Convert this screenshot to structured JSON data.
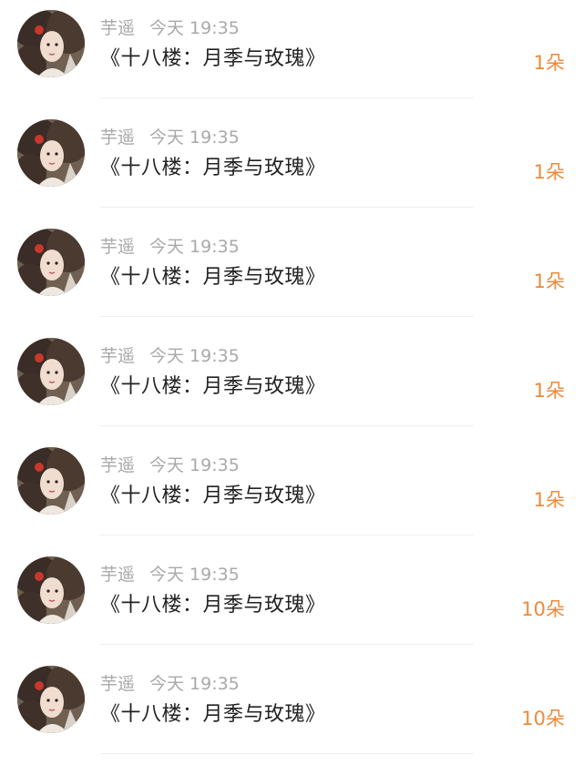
{
  "colors": {
    "name_and_time": "#a9a9a9",
    "title": "#222222",
    "count": "#ee8a3a",
    "divider": "#efefef"
  },
  "gifts": [
    {
      "user": "芋遥",
      "time": "今天 19:35",
      "title": "《十八楼：月季与玫瑰》",
      "count": "1朵",
      "avatar_icon": "user-avatar-icon"
    },
    {
      "user": "芋遥",
      "time": "今天 19:35",
      "title": "《十八楼：月季与玫瑰》",
      "count": "1朵",
      "avatar_icon": "user-avatar-icon"
    },
    {
      "user": "芋遥",
      "time": "今天 19:35",
      "title": "《十八楼：月季与玫瑰》",
      "count": "1朵",
      "avatar_icon": "user-avatar-icon"
    },
    {
      "user": "芋遥",
      "time": "今天 19:35",
      "title": "《十八楼：月季与玫瑰》",
      "count": "1朵",
      "avatar_icon": "user-avatar-icon"
    },
    {
      "user": "芋遥",
      "time": "今天 19:35",
      "title": "《十八楼：月季与玫瑰》",
      "count": "1朵",
      "avatar_icon": "user-avatar-icon"
    },
    {
      "user": "芋遥",
      "time": "今天 19:35",
      "title": "《十八楼：月季与玫瑰》",
      "count": "10朵",
      "avatar_icon": "user-avatar-icon"
    },
    {
      "user": "芋遥",
      "time": "今天 19:35",
      "title": "《十八楼：月季与玫瑰》",
      "count": "10朵",
      "avatar_icon": "user-avatar-icon"
    }
  ]
}
